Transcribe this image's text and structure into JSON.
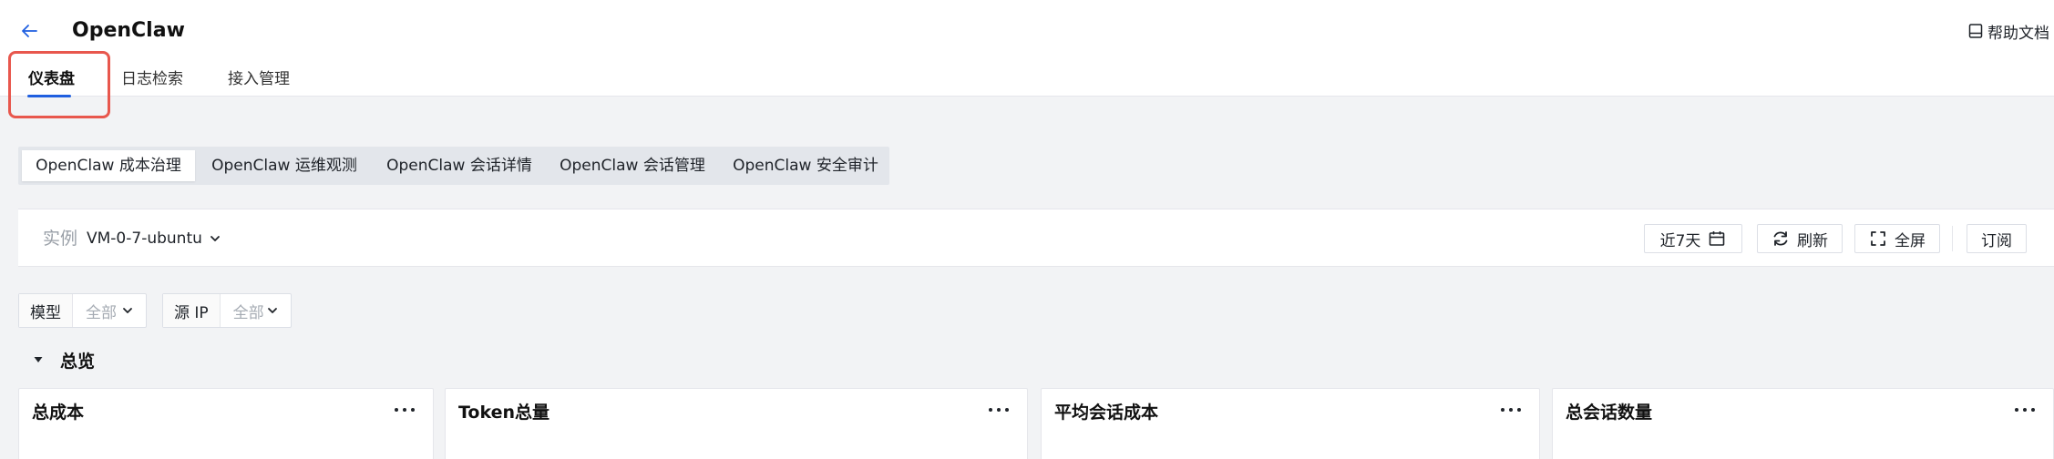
{
  "header": {
    "title": "OpenClaw",
    "help_label": "帮助文档",
    "tabs": [
      {
        "label": "仪表盘",
        "active": true
      },
      {
        "label": "日志检索",
        "active": false
      },
      {
        "label": "接入管理",
        "active": false
      }
    ]
  },
  "subtabs": [
    {
      "label": "OpenClaw 成本治理",
      "active": true
    },
    {
      "label": "OpenClaw 运维观测",
      "active": false
    },
    {
      "label": "OpenClaw 会话详情",
      "active": false
    },
    {
      "label": "OpenClaw 会话管理",
      "active": false
    },
    {
      "label": "OpenClaw 安全审计",
      "active": false
    }
  ],
  "toolbar": {
    "instance_label": "实例",
    "instance_value": "VM-0-7-ubuntu",
    "time_range": "近7天",
    "refresh_label": "刷新",
    "fullscreen_label": "全屏",
    "subscribe_label": "订阅"
  },
  "filters": [
    {
      "label": "模型",
      "value": "全部"
    },
    {
      "label": "源 IP",
      "value": "全部"
    }
  ],
  "section": {
    "title": "总览",
    "expanded": true
  },
  "cards": [
    {
      "title": "总成本"
    },
    {
      "title": "Token总量"
    },
    {
      "title": "平均会话成本"
    },
    {
      "title": "总会话数量"
    }
  ],
  "colors": {
    "accent": "#1f5fe0",
    "highlight": "#e8574d",
    "background": "#f2f3f5"
  },
  "icons": {
    "back": "arrow-left-icon",
    "help": "book-icon",
    "dropdown": "chevron-down-icon",
    "calendar": "calendar-icon",
    "refresh": "refresh-icon",
    "fullscreen": "fullscreen-icon",
    "collapse": "caret-down-icon",
    "more": "ellipsis-icon"
  }
}
